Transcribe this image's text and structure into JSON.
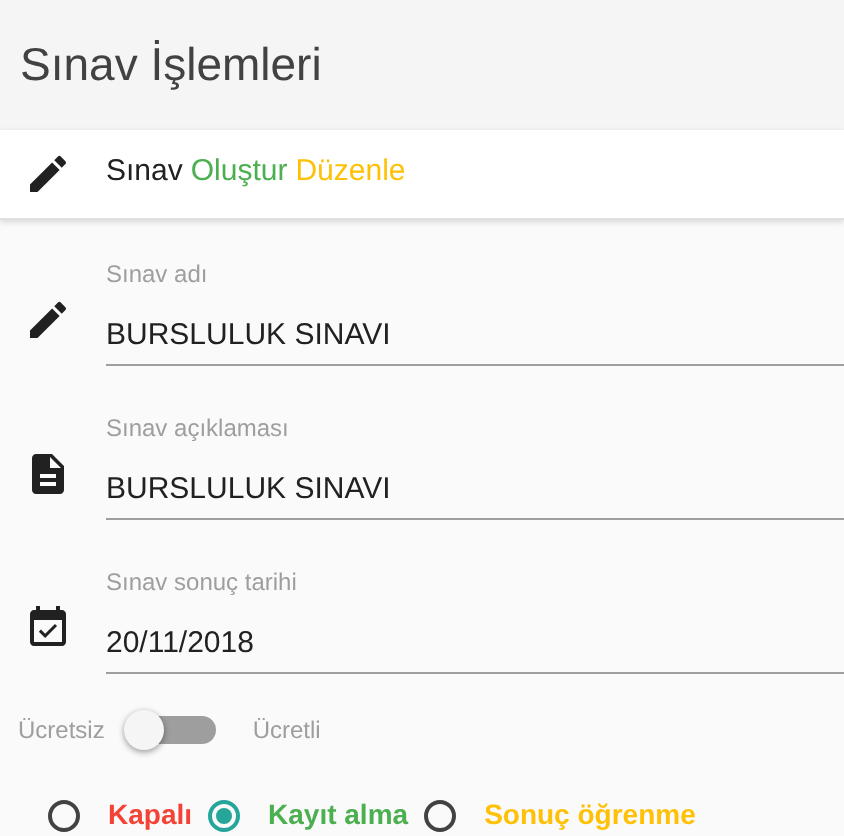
{
  "page_title": "Sınav İşlemleri",
  "card_header": {
    "segments": [
      {
        "text": "Sınav",
        "color": "#212121"
      },
      {
        "text": "Oluştur",
        "color": "#4caf50"
      },
      {
        "text": "Düzenle",
        "color": "#ffc107"
      }
    ]
  },
  "fields": [
    {
      "kind": "pencil",
      "label": "Sınav adı",
      "value": "BURSLULUK SINAVI"
    },
    {
      "kind": "document",
      "label": "Sınav açıklaması",
      "value": "BURSLULUK SINAVI"
    },
    {
      "kind": "calendar",
      "label": "Sınav sonuç tarihi",
      "value": "20/11/2018"
    }
  ],
  "fee_toggle": {
    "off_label": "Ücretsiz",
    "on_label": "Ücretli",
    "on": false
  },
  "status_options": [
    {
      "label": "Kapalı",
      "color": "#f44336",
      "selected": false
    },
    {
      "label": "Kayıt alma",
      "color": "#4caf50",
      "selected": true
    },
    {
      "label": "Sonuç öğrenme",
      "color": "#ffc107",
      "selected": false
    }
  ]
}
